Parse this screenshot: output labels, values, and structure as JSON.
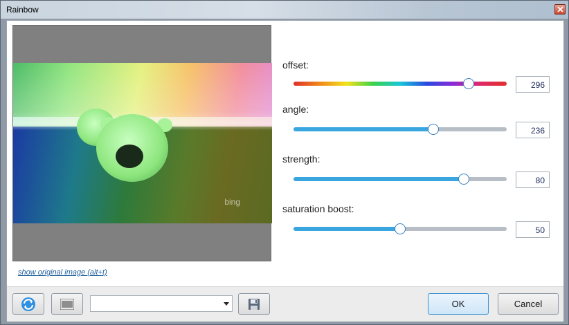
{
  "window": {
    "title": "Rainbow"
  },
  "preview": {
    "watermark": "bing",
    "show_original_link": "show original image (alt+t)"
  },
  "params": [
    {
      "label": "offset:",
      "value": "296",
      "slider_fraction": 0.82,
      "style": "hue"
    },
    {
      "label": "angle:",
      "value": "236",
      "slider_fraction": 0.655,
      "style": "fill"
    },
    {
      "label": "strength:",
      "value": "80",
      "slider_fraction": 0.8,
      "style": "fill"
    },
    {
      "label": "saturation boost:",
      "value": "50",
      "slider_fraction": 0.5,
      "style": "fill"
    }
  ],
  "footer": {
    "preset_value": "",
    "ok_label": "OK",
    "cancel_label": "Cancel"
  },
  "colors": {
    "accent": "#3aa6e0",
    "track": "#b8bec6",
    "preview_bg": "#808080",
    "link": "#1f5f9e"
  },
  "icons": {
    "refresh": "refresh-icon",
    "grid": "barcode-icon",
    "save": "save-disk-icon",
    "close": "close-icon"
  }
}
